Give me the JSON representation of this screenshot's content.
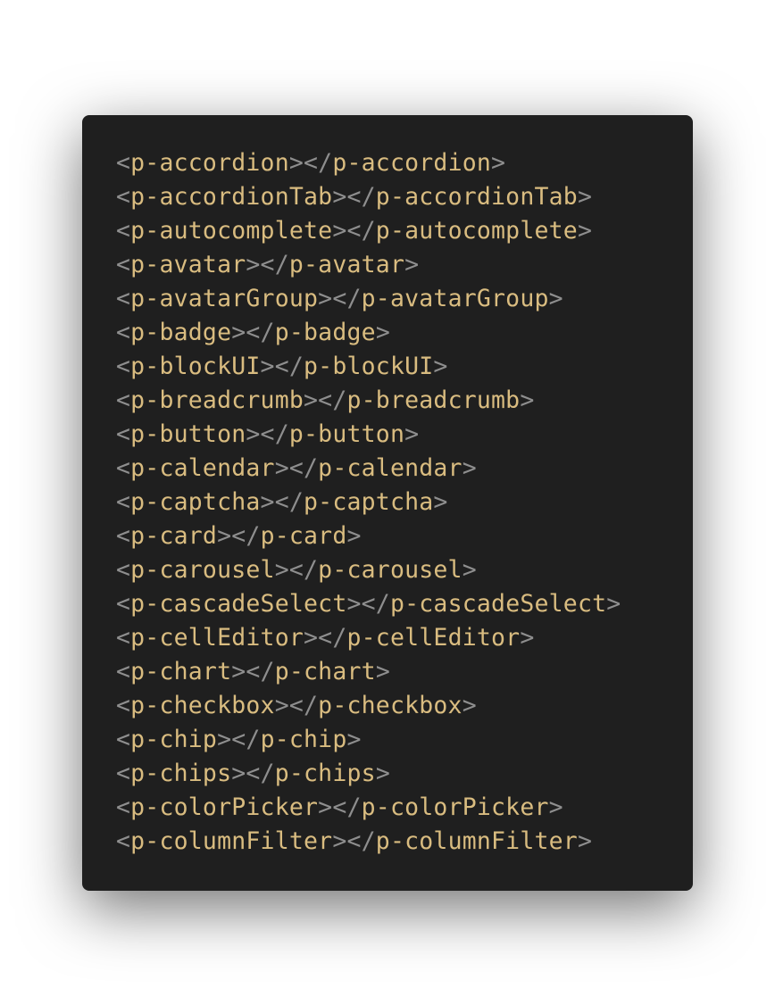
{
  "colors": {
    "background": "#1f1f1f",
    "tag_name": "#d9bc80",
    "punctuation": "#8e8e8e"
  },
  "code": {
    "tags": [
      "p-accordion",
      "p-accordionTab",
      "p-autocomplete",
      "p-avatar",
      "p-avatarGroup",
      "p-badge",
      "p-blockUI",
      "p-breadcrumb",
      "p-button",
      "p-calendar",
      "p-captcha",
      "p-card",
      "p-carousel",
      "p-cascadeSelect",
      "p-cellEditor",
      "p-chart",
      "p-checkbox",
      "p-chip",
      "p-chips",
      "p-colorPicker",
      "p-columnFilter"
    ]
  }
}
